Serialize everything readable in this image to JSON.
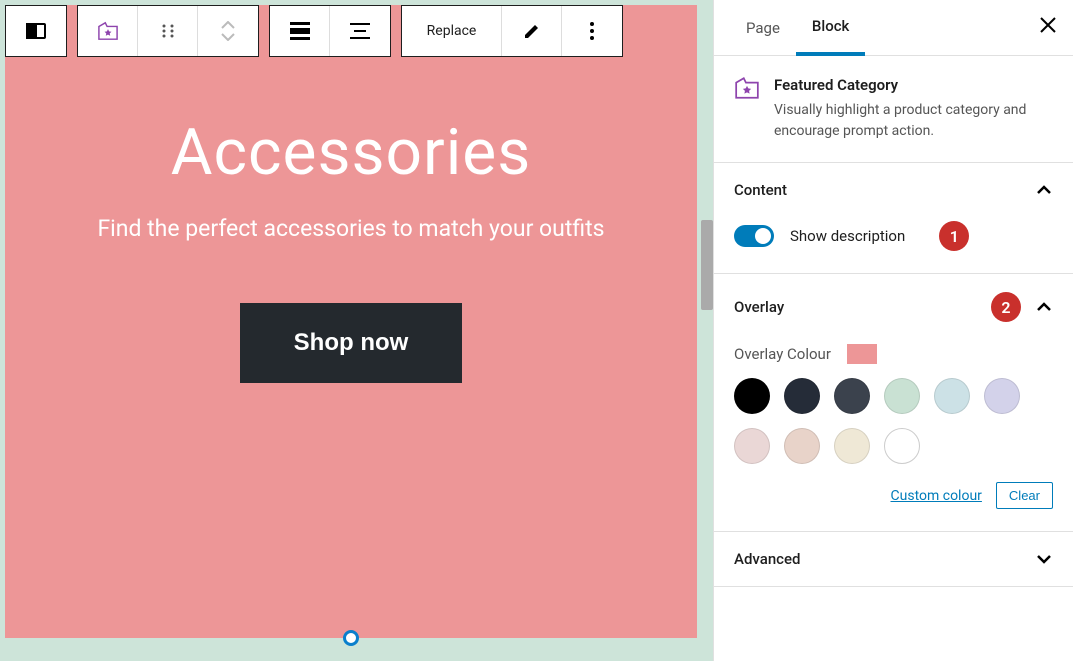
{
  "toolbar": {
    "replace_label": "Replace"
  },
  "featured": {
    "title": "Accessories",
    "description": "Find the perfect accessories to match your outfits",
    "cta": "Shop now"
  },
  "sidebar": {
    "tabs": {
      "page": "Page",
      "block": "Block"
    },
    "block_info": {
      "title": "Featured Category",
      "description": "Visually highlight a product category and encourage prompt action."
    },
    "panels": {
      "content": {
        "title": "Content",
        "show_description_label": "Show description",
        "annotation": "1"
      },
      "overlay": {
        "title": "Overlay",
        "annotation": "2",
        "colour_label": "Overlay Colour",
        "swatch_value": "#ed9697",
        "swatches": [
          "#000000",
          "#252c38",
          "#3b424d",
          "#c9e1d3",
          "#cce1e6",
          "#d3d2ea",
          "#ead7d6",
          "#e8d3c9",
          "#efe8d6",
          "#ffffff"
        ],
        "custom_link": "Custom colour",
        "clear_label": "Clear"
      },
      "advanced": {
        "title": "Advanced"
      }
    }
  }
}
